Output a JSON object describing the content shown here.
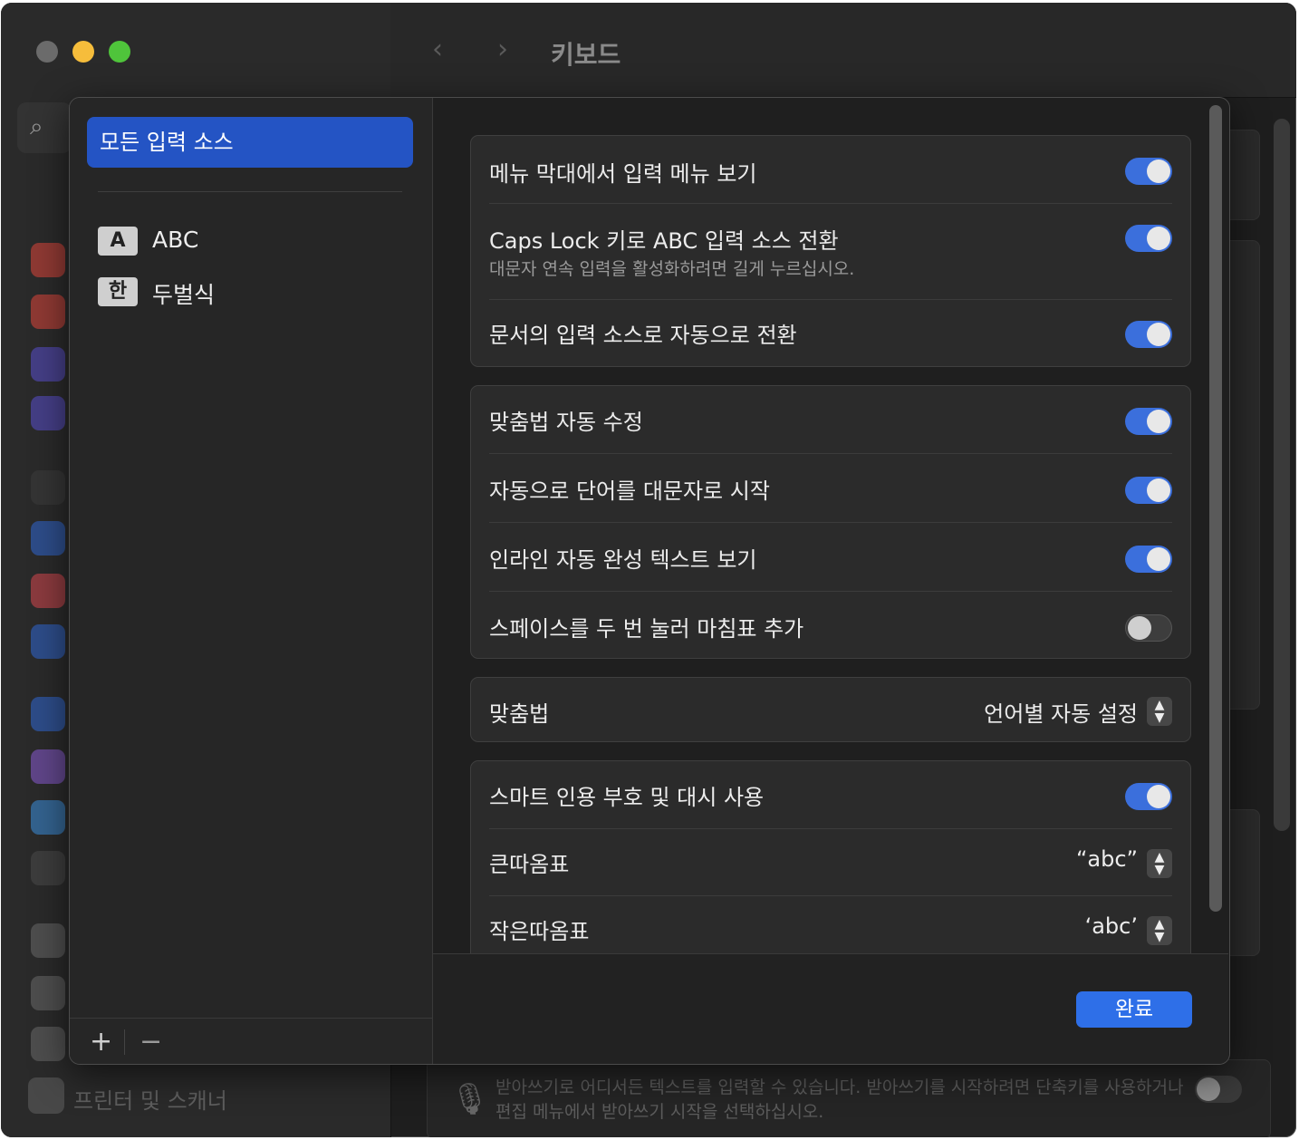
{
  "window": {
    "title": "키보드",
    "background_footer_text": "받아쓰기로 어디서든 텍스트를 입력할 수 있습니다. 받아쓰기를 시작하려면 단축키를 사용하거나 편집 메뉴에서 받아쓰기 시작을 선택하십시오.",
    "background_sidebar_label": "프린터 및 스캐너"
  },
  "sources": {
    "all_label": "모든 입력 소스",
    "items": [
      {
        "badge": "A",
        "label": "ABC"
      },
      {
        "badge": "한",
        "label": "두벌식"
      }
    ],
    "add_symbol": "+",
    "remove_symbol": "−"
  },
  "settings": {
    "group1": [
      {
        "label": "메뉴 막대에서 입력 메뉴 보기",
        "on": true
      },
      {
        "label": "Caps Lock 키로 ABC 입력 소스 전환",
        "sub": "대문자 연속 입력을 활성화하려면 길게 누르십시오.",
        "on": true
      },
      {
        "label": "문서의 입력 소스로 자동으로 전환",
        "on": true
      }
    ],
    "group2": [
      {
        "label": "맞춤법 자동 수정",
        "on": true
      },
      {
        "label": "자동으로 단어를 대문자로 시작",
        "on": true
      },
      {
        "label": "인라인 자동 완성 텍스트 보기",
        "on": true
      },
      {
        "label": "스페이스를 두 번 눌러 마침표 추가",
        "on": false
      }
    ],
    "spelling": {
      "label": "맞춤법",
      "value": "언어별 자동 설정"
    },
    "group4": {
      "smart_quotes": {
        "label": "스마트 인용 부호 및 대시 사용",
        "on": true
      },
      "double_quotes": {
        "label": "큰따옴표",
        "value": "“abc”"
      },
      "single_quotes": {
        "label": "작은따옴표",
        "value": "‘abc’"
      }
    }
  },
  "done_label": "완료",
  "colors": {
    "accent": "#2e6fe8",
    "selection": "#2454c4",
    "toggle_on": "#3b6fdc"
  }
}
